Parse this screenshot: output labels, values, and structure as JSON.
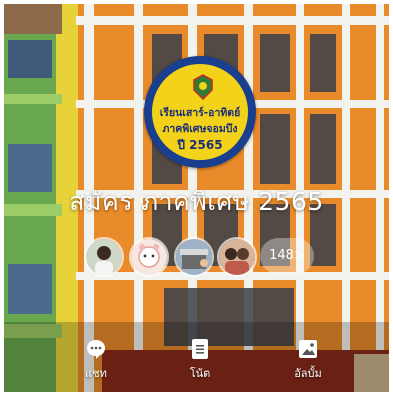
{
  "badge": {
    "line1": "เรียนเสาร์-อาทิตย์",
    "line2": "ภาคพิเศษจอมบึง",
    "line3": "ปี 2565"
  },
  "title": "สมัคร ภาคพิเศษ 2565",
  "members": {
    "more_label": "148>"
  },
  "tabs": {
    "chat": "แชท",
    "note": "โน้ต",
    "album": "อัลบั้ม"
  },
  "colors": {
    "badge_ring": "#1a3f8f",
    "badge_fill": "#f3d21a",
    "building_orange": "#e98b2a",
    "building_green": "#5fa83a"
  }
}
